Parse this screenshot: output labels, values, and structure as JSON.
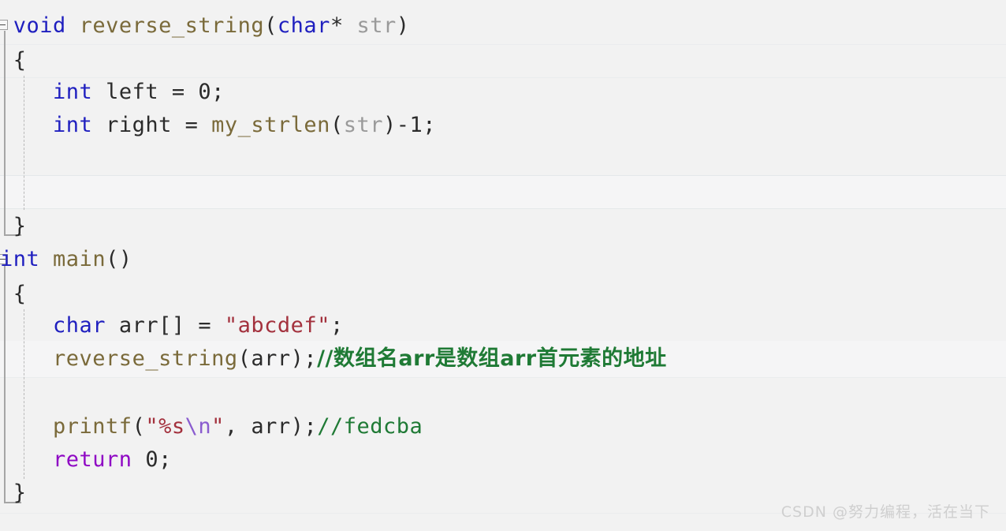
{
  "editor": {
    "background": "#f2f2f2",
    "watermark": "CSDN @努力编程，活在当下"
  },
  "palette": {
    "keyword": "#1f1fbf",
    "control_keyword": "#8f08c4",
    "function": "#7a6a3a",
    "parameter": "#9a9a9a",
    "identifier": "#2b2b2b",
    "string": "#a3313d",
    "escape": "#8a5ccf",
    "comment": "#1f7a35",
    "fold_marker": "#9d9d9d"
  },
  "code": {
    "l1_kw_void": "void",
    "l1_sp1": " ",
    "l1_fn": "reverse_string",
    "l1_paren_open": "(",
    "l1_kw_char": "char",
    "l1_star_sp": "* ",
    "l1_param_str": "str",
    "l1_paren_close": ")",
    "l2_brace_open": "{",
    "l3_indent": "    ",
    "l3_kw_int": "int",
    "l3_sp": " ",
    "l3_id_left": "left",
    "l3_eq": " = ",
    "l3_num0": "0",
    "l3_semi": ";",
    "l4_indent": "    ",
    "l4_kw_int": "int",
    "l4_sp": " ",
    "l4_id_right": "right",
    "l4_eq": " = ",
    "l4_fn_mystrlen": "my_strlen",
    "l4_paren_open": "(",
    "l4_param_str": "str",
    "l4_paren_close": ")",
    "l4_minus1": "-1",
    "l4_semi": ";",
    "l7_brace_close": "}",
    "l8_kw_int": "int",
    "l8_sp": " ",
    "l8_fn_main": "main",
    "l8_parens": "()",
    "l9_brace_open": "{",
    "l10_indent": "    ",
    "l10_kw_char": "char",
    "l10_sp": " ",
    "l10_id_arr": "arr",
    "l10_brackets": "[]",
    "l10_eq": " = ",
    "l10_str": "\"abcdef\"",
    "l10_semi": ";",
    "l11_indent": "    ",
    "l11_fn": "reverse_string",
    "l11_paren_open": "(",
    "l11_id_arr": "arr",
    "l11_paren_close_semi": ");",
    "l11_comment": "//数组名arr是数组arr首元素的地址",
    "l13_indent": "    ",
    "l13_fn_printf": "printf",
    "l13_paren_open": "(",
    "l13_str_open": "\"%s",
    "l13_esc": "\\n",
    "l13_str_close": "\"",
    "l13_comma_sp": ", ",
    "l13_id_arr": "arr",
    "l13_paren_close_semi": ");",
    "l13_comment": "//fedcba",
    "l14_indent": "    ",
    "l14_ctl_return": "return",
    "l14_sp": " ",
    "l14_num0": "0",
    "l14_semi": ";",
    "l15_brace_close": "}"
  }
}
